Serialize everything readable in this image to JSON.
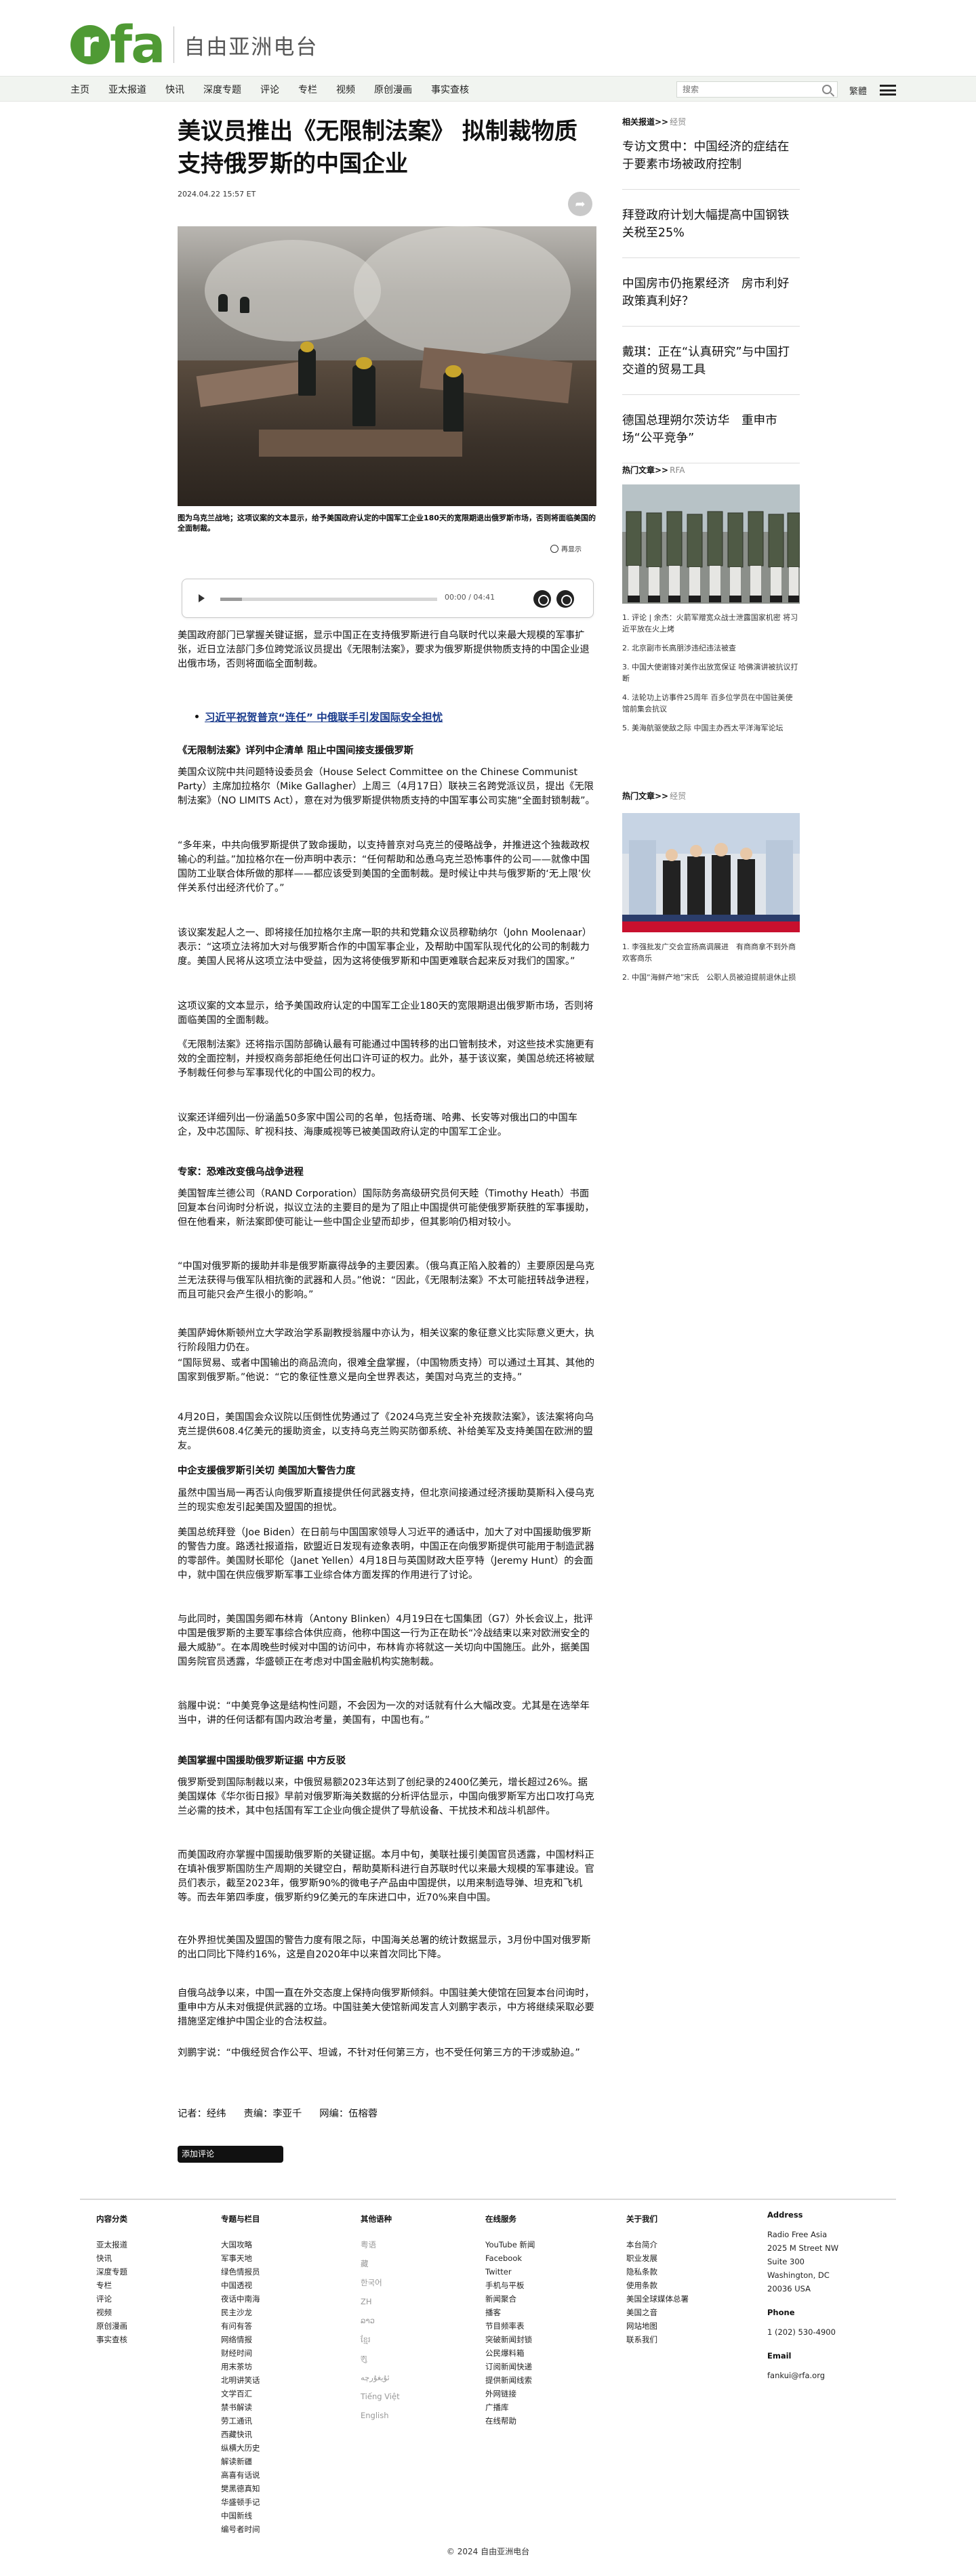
{
  "header": {
    "logo_letter": "r",
    "logo_text": "fa",
    "site_name": "自由亚洲电台",
    "brand_color": "#4f9a34"
  },
  "nav": {
    "items": [
      "主页",
      "亚太报道",
      "快讯",
      "深度专题",
      "评论",
      "专栏",
      "视频",
      "原创漫画",
      "事实查核"
    ],
    "search_placeholder": "搜索",
    "language": "繁體"
  },
  "article": {
    "title": "美议员推出《无限制法案》 拟制裁物质支持俄罗斯的中国企业",
    "date": "2024.04.22 15:57 ET",
    "caption": "图为乌克兰战地；这项议案的文本显示，给予美国政府认定的中国军工企业180天的宽限期退出俄罗斯市场，否则将面临美国的全面制裁。",
    "enlarge": "再显示",
    "audio_time": "00:00 / 04:41",
    "audio_progress": 0.1,
    "related_link": "习近平祝贺普京“连任” 中俄联手引发国际安全担忧",
    "paragraphs": [
      "美国政府部门已掌握关键证据，显示中国正在支持俄罗斯进行自乌联时代以来最大规模的军事扩张，近日立法部门多位跨党派议员提出《无限制法案》，要求为俄罗斯提供物质支持的中国企业退出俄市场，否则将面临全面制裁。",
      "《无限制法案》详列中企清单 阻止中国间接支援俄罗斯",
      "美国众议院中共问题特设委员会（House Select Committee on the Chinese Communist Party）主席加拉格尔（Mike Gallagher）上周三（4月17日）联袂三名跨党派议员，提出《无限制法案》（NO LIMITS Act），意在对为俄罗斯提供物质支持的中国军事公司实施“全面封锁制裁”。",
      "“多年来，中共向俄罗斯提供了致命援助，以支持普京对乌克兰的侵略战争，并推进这个独裁政权输心的利益。”加拉格尔在一份声明中表示：“任何帮助和怂恿乌克兰恐怖事件的公司——就像中国国防工业联合体所做的那样——都应该受到美国的全面制裁。是时候让中共与俄罗斯的‘无上限’伙伴关系付出经济代价了。”",
      "该议案发起人之一、即将接任加拉格尔主席一职的共和党籍众议员穆勒纳尔（John Moolenaar）表示：“这项立法将加大对与俄罗斯合作的中国军事企业，及帮助中国军队现代化的公司的制裁力度。美国人民将从这项立法中受益，因为这将使俄罗斯和中国更难联合起来反对我们的国家。”",
      "这项议案的文本显示，给予美国政府认定的中国军工企业180天的宽限期退出俄罗斯市场，否则将面临美国的全面制裁。",
      "《无限制法案》还将指示国防部确认最有可能通过中国转移的出口管制技术，对这些技术实施更有效的全面控制，并授权商务部拒绝任何出口许可证的权力。此外，基于该议案，美国总统还将被赋予制裁任何参与军事现代化的中国公司的权力。",
      "议案还详细列出一份涵盖50多家中国公司的名单，包括奇瑞、哈弗、长安等对俄出口的中国车企，及中芯国际、旷视科技、海康威视等已被美国政府认定的中国军工企业。",
      "专家：恐难改变俄乌战争进程",
      "美国智库兰德公司（RAND Corporation）国际防务高级研究员何天睦（Timothy Heath）书面回复本台问询时分析说，拟议立法的主要目的是为了阻止中国提供可能使俄罗斯获胜的军事援助，但在他看来，新法案即使可能让一些中国企业望而却步，但其影响仍相对较小。",
      "“中国对俄罗斯的援助并非是俄罗斯赢得战争的主要因素。（俄乌真正陷入胶着的）主要原因是乌克兰无法获得与俄军队相抗衡的武器和人员。”他说：“因此，《无限制法案》不太可能扭转战争进程，而且可能只会产生很小的影响。”",
      "美国萨姆休斯顿州立大学政治学系副教授翁履中亦认为，相关议案的象征意义比实际意义更大，执行阶段阻力仍在。",
      "“国际贸易、或者中国输出的商品流向，很难全盘掌握，（中国物质支持）可以通过土耳其、其他的国家到俄罗斯。”他说：“它的象征性意义是向全世界表达，美国对乌克兰的支持。”",
      "4月20日，美国国会众议院以压倒性优势通过了《2024乌克兰安全补充拨款法案》，该法案将向乌克兰提供608.4亿美元的援助资金，以支持乌克兰购买防御系统、补给美军及支持美国在欧洲的盟友。",
      "中企支援俄罗斯引关切 美国加大警告力度",
      "虽然中国当局一再否认向俄罗斯直接提供任何武器支持，但北京间接通过经济援助莫斯科入侵乌克兰的现实愈发引起美国及盟国的担忧。",
      "美国总统拜登（Joe Biden）在日前与中国国家领导人习近平的通话中，加大了对中国援助俄罗斯的警告力度。路透社报道指，欧盟近日发现有迹象表明，中国正在向俄罗斯提供可能用于制造武器的零部件。美国财长耶伦（Janet Yellen）4月18日与英国财政大臣亨特（Jeremy Hunt）的会面中，就中国在供应俄罗斯军事工业综合体方面发挥的作用进行了讨论。",
      "与此同时，美国国务卿布林肯（Antony Blinken）4月19日在七国集团（G7）外长会议上，批评中国是俄罗斯的主要军事综合体供应商，他称中国这一行为正在助长“冷战结束以来对欧洲安全的最大威胁”。在本周晚些时候对中国的访问中，布林肯亦将就这一关切向中国施压。此外，据美国国务院官员透露，华盛顿正在考虑对中国金融机构实施制裁。",
      "翁履中说：“中美竞争这是结构性问题，不会因为一次的对话就有什么大幅改变。尤其是在选举年当中，讲的任何话都有国内政治考量，美国有，中国也有。”",
      "美国掌握中国援助俄罗斯证据 中方反驳",
      "俄罗斯受到国际制裁以来，中俄贸易额2023年达到了创纪录的2400亿美元，增长超过26%。据美国媒体《华尔街日报》早前对俄罗斯海关数据的分析评估显示，中国向俄罗斯军方出口攻打乌克兰必需的技术，其中包括国有军工企业向俄企提供了导航设备、干扰技术和战斗机部件。",
      "而美国政府亦掌握中国援助俄罗斯的关键证据。本月中旬，美联社援引美国官员透露，中国材料正在填补俄罗斯国防生产周期的关键空白，帮助莫斯科进行自苏联时代以来最大规模的军事建设。官员们表示，截至2023年，俄罗斯90%的微电子产品由中国提供，以用来制造导弹、坦克和飞机等。而去年第四季度，俄罗斯约9亿美元的车床进口中，近70%来自中国。",
      "在外界担忧美国及盟国的警告力度有限之际，中国海关总署的统计数据显示，3月份中国对俄罗斯的出口同比下降约16%，这是自2020年中以来首次同比下降。",
      "自俄乌战争以来，中国一直在外交态度上保持向俄罗斯倾斜。中国驻美大使馆在回复本台问询时，重申中方从未对俄提供武器的立场。中国驻美大使馆新闻发言人刘鹏宇表示，中方将继续采取必要措施坚定维护中国企业的合法权益。",
      "刘鹏宇说：“中俄经贸合作公平、坦诚，不针对任何第三方，也不受任何第三方的干涉或胁迫。”"
    ],
    "byline": {
      "reporter": "记者：经纬",
      "editor": "责编：李亚千",
      "web_editor": "网编：伍榕蓉"
    },
    "comment_button": "添加评论"
  },
  "sidebar": {
    "related_head": "相关报道>>",
    "related_sub": "经贸",
    "related_items": [
      "专访文贯中：中国经济的症结在于要素市场被政府控制",
      "拜登政府计划大幅提高中国钢铁关税至25%",
      "中国房市仍拖累经济　房市利好政策真利好？",
      "戴琪：正在“认真研究”与中国打交道的贸易工具",
      "德国总理朔尔茨访华　重申市场“公平竞争”"
    ],
    "hot_head": "热门文章>>",
    "hot_sub": "RFA",
    "hot_list": [
      "1. 评论 | 余杰：火箭军赠宽众战士泄露国家机密 将习近平放在火上烤",
      "2. 北京副市长高朋涉违纪违法被查",
      "3. 中国大使谢锋对美作出放宽保证 哈佛演讲被抗议打断",
      "4. 法轮功上访事件25周年 百多位学员在中国驻美使馆前集会抗议",
      "5. 美海航驱使敌之际 中国主办西太平洋海军论坛"
    ],
    "hot2_head": "热门文章>>",
    "hot2_sub": "经贸",
    "hot2_list": [
      "1. 李强批发广交会宣扬高调展进　有商商拿不到外商欢客商乐",
      "2. 中国“海鲜产地”宋氏　公职人员被迫提前退休止损"
    ]
  },
  "footer": {
    "columns": [
      {
        "head": "内容分类",
        "items": [
          "亚太报道",
          "快讯",
          "深度专题",
          "专栏",
          "评论",
          "视频",
          "原创漫画",
          "事实查核"
        ]
      },
      {
        "head": "专题与栏目",
        "items": [
          "大国攻略",
          "军事天地",
          "绿色情报员",
          "中国透视",
          "夜话中南海",
          "民主沙龙",
          "有问有答",
          "网络情报",
          "财经时间",
          "用末茶坊",
          "北明讲笑话",
          "文学百汇",
          "禁书解读",
          "劳工通讯",
          "西藏快讯",
          "纵横大历史",
          "解读新疆",
          "高喜有话说",
          "樊黑德真知",
          "华盛顿手记",
          "中国新线",
          "编号者时间"
        ]
      },
      {
        "head": "其他语种",
        "items": [
          "粤语",
          "藏",
          "한국어",
          "ZH",
          "ລາວ",
          "ខ្មែរ",
          "ཨུ",
          "ئۇيغۇرچە",
          "Tiếng Việt",
          "English"
        ]
      },
      {
        "head": "在线服务",
        "items": [
          "YouTube 新闻",
          "Facebook",
          "Twitter",
          "手机与平板",
          "新闻聚合",
          "播客",
          "节目频率表",
          "突破新闻封锁",
          "公民爆料箱",
          "订阅新闻快递",
          "提供新闻线索",
          "外网链接",
          "广播库",
          "在线帮助"
        ]
      },
      {
        "head": "关于我们",
        "items": [
          "本台简介",
          "职业发展",
          "隐私条款",
          "使用条款",
          "美国全球媒体总署",
          "美国之音",
          "网站地图",
          "联系我们"
        ]
      }
    ],
    "address_head": "Address",
    "address": [
      "Radio Free Asia",
      "2025 M Street NW",
      "Suite 300",
      "Washington, DC",
      "20036 USA"
    ],
    "phone_head": "Phone",
    "phone": "1 (202) 530-4900",
    "email_head": "Email",
    "email": "fankui@rfa.org",
    "copyright": "© 2024 自由亚洲电台"
  }
}
